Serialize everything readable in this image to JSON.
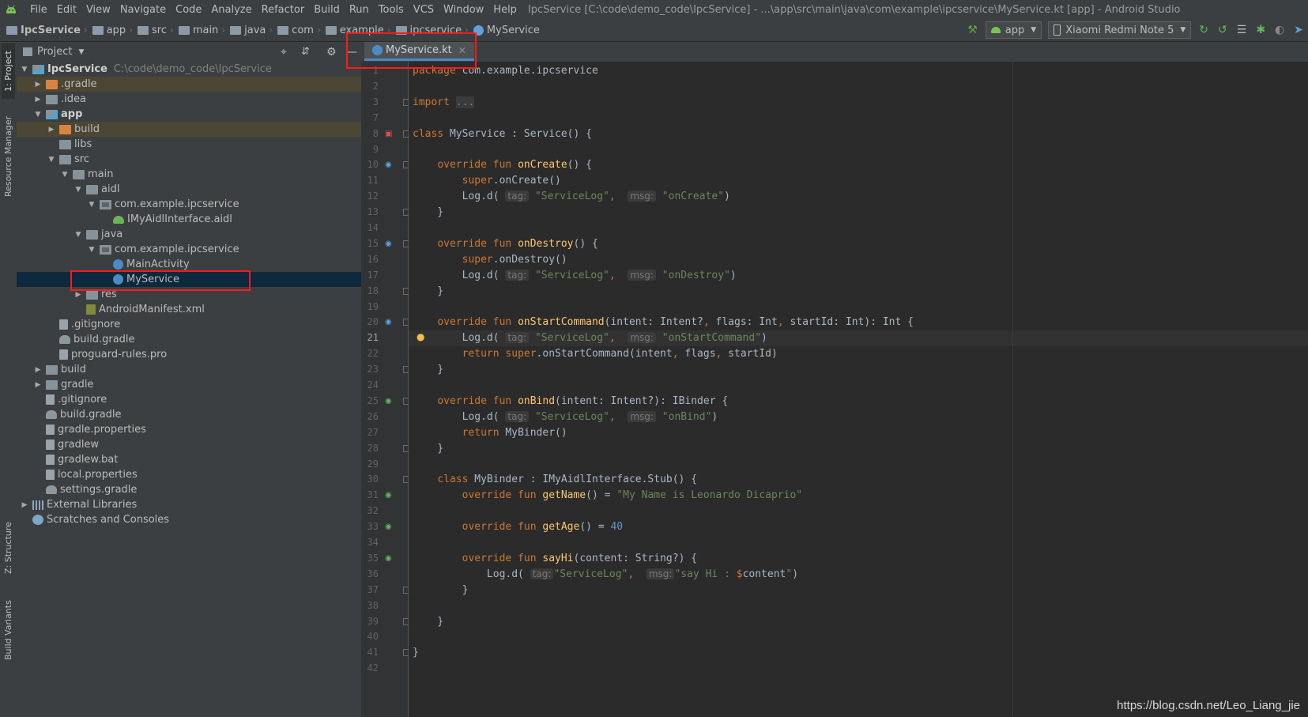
{
  "menubar": {
    "items": [
      "File",
      "Edit",
      "View",
      "Navigate",
      "Code",
      "Analyze",
      "Refactor",
      "Build",
      "Run",
      "Tools",
      "VCS",
      "Window",
      "Help"
    ],
    "mnemonics": [
      "F",
      "E",
      "V",
      "N",
      "C",
      "z",
      "R",
      "B",
      "u",
      "T",
      "S",
      "W",
      "H"
    ],
    "window_title": "IpcService [C:\\code\\demo_code\\IpcService] - ...\\app\\src\\main\\java\\com\\example\\ipcservice\\MyService.kt [app] - Android Studio"
  },
  "breadcrumbs": [
    "IpcService",
    "app",
    "src",
    "main",
    "java",
    "com",
    "example",
    "ipcservice",
    "MyService"
  ],
  "toolbar": {
    "run_config": "app",
    "device": "Xiaomi Redmi Note 5"
  },
  "stripe": {
    "project_tab": "1: Project",
    "resource_tab": "Resource Manager",
    "structure_tab": "Z: Structure",
    "variants_tab": "Build Variants"
  },
  "project_panel": {
    "title": "Project",
    "tree": [
      {
        "label": "IpcService",
        "path": "C:\\code\\demo_code\\IpcService",
        "depth": 0,
        "arrow": "down",
        "icon": "modfolder",
        "bold": true
      },
      {
        "label": ".gradle",
        "depth": 1,
        "arrow": "right",
        "icon": "ofolder",
        "hl": true
      },
      {
        "label": ".idea",
        "depth": 1,
        "arrow": "right",
        "icon": "folder"
      },
      {
        "label": "app",
        "depth": 1,
        "arrow": "down",
        "icon": "modfolder",
        "bold": true
      },
      {
        "label": "build",
        "depth": 2,
        "arrow": "right",
        "icon": "ofolder",
        "hl": true
      },
      {
        "label": "libs",
        "depth": 2,
        "arrow": "",
        "icon": "folder"
      },
      {
        "label": "src",
        "depth": 2,
        "arrow": "down",
        "icon": "folder"
      },
      {
        "label": "main",
        "depth": 3,
        "arrow": "down",
        "icon": "folder"
      },
      {
        "label": "aidl",
        "depth": 4,
        "arrow": "down",
        "icon": "folder"
      },
      {
        "label": "com.example.ipcservice",
        "depth": 5,
        "arrow": "down",
        "icon": "pkg"
      },
      {
        "label": "IMyAidlInterface.aidl",
        "depth": 6,
        "arrow": "",
        "icon": "andr"
      },
      {
        "label": "java",
        "depth": 4,
        "arrow": "down",
        "icon": "folder"
      },
      {
        "label": "com.example.ipcservice",
        "depth": 5,
        "arrow": "down",
        "icon": "pkg"
      },
      {
        "label": "MainActivity",
        "depth": 6,
        "arrow": "",
        "icon": "kt"
      },
      {
        "label": "MyService",
        "depth": 6,
        "arrow": "",
        "icon": "kt",
        "sel": true
      },
      {
        "label": "res",
        "depth": 4,
        "arrow": "right",
        "icon": "folder"
      },
      {
        "label": "AndroidManifest.xml",
        "depth": 4,
        "arrow": "",
        "icon": "xml"
      },
      {
        "label": ".gitignore",
        "depth": 2,
        "arrow": "",
        "icon": "file"
      },
      {
        "label": "build.gradle",
        "depth": 2,
        "arrow": "",
        "icon": "gradle"
      },
      {
        "label": "proguard-rules.pro",
        "depth": 2,
        "arrow": "",
        "icon": "file"
      },
      {
        "label": "build",
        "depth": 1,
        "arrow": "right",
        "icon": "folder"
      },
      {
        "label": "gradle",
        "depth": 1,
        "arrow": "right",
        "icon": "folder"
      },
      {
        "label": ".gitignore",
        "depth": 1,
        "arrow": "",
        "icon": "file"
      },
      {
        "label": "build.gradle",
        "depth": 1,
        "arrow": "",
        "icon": "gradle"
      },
      {
        "label": "gradle.properties",
        "depth": 1,
        "arrow": "",
        "icon": "file"
      },
      {
        "label": "gradlew",
        "depth": 1,
        "arrow": "",
        "icon": "file"
      },
      {
        "label": "gradlew.bat",
        "depth": 1,
        "arrow": "",
        "icon": "file"
      },
      {
        "label": "local.properties",
        "depth": 1,
        "arrow": "",
        "icon": "file"
      },
      {
        "label": "settings.gradle",
        "depth": 1,
        "arrow": "",
        "icon": "gradle"
      },
      {
        "label": "External Libraries",
        "depth": 0,
        "arrow": "right",
        "icon": "lib"
      },
      {
        "label": "Scratches and Consoles",
        "depth": 0,
        "arrow": "",
        "icon": "scr"
      }
    ]
  },
  "editor": {
    "tab_label": "MyService.kt",
    "current_line": 21,
    "lines": [
      {
        "n": 1,
        "code": [
          [
            "kw",
            "package"
          ],
          [
            "pl",
            " com.example.ipcservice"
          ]
        ]
      },
      {
        "n": 2,
        "code": []
      },
      {
        "n": 3,
        "code": [
          [
            "kw",
            "import"
          ],
          [
            "pl",
            " "
          ],
          [
            "dim",
            "..."
          ]
        ]
      },
      {
        "n": 7,
        "code": []
      },
      {
        "n": 8,
        "code": [
          [
            "kw",
            "class"
          ],
          [
            "pl",
            " MyService : Service() {"
          ]
        ]
      },
      {
        "n": 9,
        "code": []
      },
      {
        "n": 10,
        "code": [
          [
            "pl",
            "    "
          ],
          [
            "kw",
            "override fun"
          ],
          [
            "pl",
            " "
          ],
          [
            "fn",
            "onCreate"
          ],
          [
            "pl",
            "() {"
          ]
        ]
      },
      {
        "n": 11,
        "code": [
          [
            "pl",
            "        "
          ],
          [
            "kw",
            "super"
          ],
          [
            "pl",
            ".onCreate()"
          ]
        ]
      },
      {
        "n": 12,
        "code": [
          [
            "pl",
            "        Log.d( "
          ],
          [
            "hint",
            "tag:"
          ],
          [
            "pl",
            " "
          ],
          [
            "st",
            "\"ServiceLog\""
          ],
          [
            "fv",
            ","
          ],
          [
            "pl",
            "  "
          ],
          [
            "hint",
            "msg:"
          ],
          [
            "pl",
            " "
          ],
          [
            "st",
            "\"onCreate\""
          ],
          [
            "pl",
            ")"
          ]
        ]
      },
      {
        "n": 13,
        "code": [
          [
            "pl",
            "    }"
          ]
        ]
      },
      {
        "n": 14,
        "code": []
      },
      {
        "n": 15,
        "code": [
          [
            "pl",
            "    "
          ],
          [
            "kw",
            "override fun"
          ],
          [
            "pl",
            " "
          ],
          [
            "fn",
            "onDestroy"
          ],
          [
            "pl",
            "() {"
          ]
        ]
      },
      {
        "n": 16,
        "code": [
          [
            "pl",
            "        "
          ],
          [
            "kw",
            "super"
          ],
          [
            "pl",
            ".onDestroy()"
          ]
        ]
      },
      {
        "n": 17,
        "code": [
          [
            "pl",
            "        Log.d( "
          ],
          [
            "hint",
            "tag:"
          ],
          [
            "pl",
            " "
          ],
          [
            "st",
            "\"ServiceLog\""
          ],
          [
            "fv",
            ","
          ],
          [
            "pl",
            "  "
          ],
          [
            "hint",
            "msg:"
          ],
          [
            "pl",
            " "
          ],
          [
            "st",
            "\"onDestroy\""
          ],
          [
            "pl",
            ")"
          ]
        ]
      },
      {
        "n": 18,
        "code": [
          [
            "pl",
            "    }"
          ]
        ]
      },
      {
        "n": 19,
        "code": []
      },
      {
        "n": 20,
        "code": [
          [
            "pl",
            "    "
          ],
          [
            "kw",
            "override fun"
          ],
          [
            "pl",
            " "
          ],
          [
            "fn",
            "onStartCommand"
          ],
          [
            "pl",
            "(intent: Intent?"
          ],
          [
            "fv",
            ","
          ],
          [
            "pl",
            " flags: Int"
          ],
          [
            "fv",
            ","
          ],
          [
            "pl",
            " startId: Int): Int {"
          ]
        ]
      },
      {
        "n": 21,
        "code": [
          [
            "pl",
            "        Log.d( "
          ],
          [
            "hint",
            "tag:"
          ],
          [
            "pl",
            " "
          ],
          [
            "st",
            "\"ServiceLog\""
          ],
          [
            "fv",
            ","
          ],
          [
            "pl",
            "  "
          ],
          [
            "hint",
            "msg:"
          ],
          [
            "pl",
            " "
          ],
          [
            "st",
            "\"onStartCommand\""
          ],
          [
            "pl",
            ")"
          ]
        ]
      },
      {
        "n": 22,
        "code": [
          [
            "pl",
            "        "
          ],
          [
            "kw",
            "return super"
          ],
          [
            "pl",
            ".onStartCommand(intent"
          ],
          [
            "fv",
            ","
          ],
          [
            "pl",
            " flags"
          ],
          [
            "fv",
            ","
          ],
          [
            "pl",
            " startId)"
          ]
        ]
      },
      {
        "n": 23,
        "code": [
          [
            "pl",
            "    }"
          ]
        ]
      },
      {
        "n": 24,
        "code": []
      },
      {
        "n": 25,
        "code": [
          [
            "pl",
            "    "
          ],
          [
            "kw",
            "override fun"
          ],
          [
            "pl",
            " "
          ],
          [
            "fn",
            "onBind"
          ],
          [
            "pl",
            "(intent: Intent?): IBinder {"
          ]
        ]
      },
      {
        "n": 26,
        "code": [
          [
            "pl",
            "        Log.d( "
          ],
          [
            "hint",
            "tag:"
          ],
          [
            "pl",
            " "
          ],
          [
            "st",
            "\"ServiceLog\""
          ],
          [
            "fv",
            ","
          ],
          [
            "pl",
            "  "
          ],
          [
            "hint",
            "msg:"
          ],
          [
            "pl",
            " "
          ],
          [
            "st",
            "\"onBind\""
          ],
          [
            "pl",
            ")"
          ]
        ]
      },
      {
        "n": 27,
        "code": [
          [
            "pl",
            "        "
          ],
          [
            "kw",
            "return"
          ],
          [
            "pl",
            " MyBinder()"
          ]
        ]
      },
      {
        "n": 28,
        "code": [
          [
            "pl",
            "    }"
          ]
        ]
      },
      {
        "n": 29,
        "code": []
      },
      {
        "n": 30,
        "code": [
          [
            "pl",
            "    "
          ],
          [
            "kw",
            "class"
          ],
          [
            "pl",
            " MyBinder : IMyAidlInterface.Stub() {"
          ]
        ]
      },
      {
        "n": 31,
        "code": [
          [
            "pl",
            "        "
          ],
          [
            "kw",
            "override fun"
          ],
          [
            "pl",
            " "
          ],
          [
            "fn",
            "getName"
          ],
          [
            "pl",
            "() = "
          ],
          [
            "st",
            "\"My Name is Leonardo Dicaprio\""
          ]
        ]
      },
      {
        "n": 32,
        "code": []
      },
      {
        "n": 33,
        "code": [
          [
            "pl",
            "        "
          ],
          [
            "kw",
            "override fun"
          ],
          [
            "pl",
            " "
          ],
          [
            "fn",
            "getAge"
          ],
          [
            "pl",
            "() = "
          ],
          [
            "nm",
            "40"
          ]
        ]
      },
      {
        "n": 34,
        "code": []
      },
      {
        "n": 35,
        "code": [
          [
            "pl",
            "        "
          ],
          [
            "kw",
            "override fun"
          ],
          [
            "pl",
            " "
          ],
          [
            "fn",
            "sayHi"
          ],
          [
            "pl",
            "(content: String?) {"
          ]
        ]
      },
      {
        "n": 36,
        "code": [
          [
            "pl",
            "            Log.d( "
          ],
          [
            "hint",
            "tag:"
          ],
          [
            "st",
            "\"ServiceLog\""
          ],
          [
            "fv",
            ","
          ],
          [
            "pl",
            "  "
          ],
          [
            "hint",
            "msg:"
          ],
          [
            "st",
            "\"say Hi : "
          ],
          [
            "kw",
            "$"
          ],
          [
            "pl",
            "content"
          ],
          [
            "st",
            "\""
          ],
          [
            "pl",
            ")"
          ]
        ]
      },
      {
        "n": 37,
        "code": [
          [
            "pl",
            "        }"
          ]
        ]
      },
      {
        "n": 38,
        "code": []
      },
      {
        "n": 39,
        "code": [
          [
            "pl",
            "    }"
          ]
        ]
      },
      {
        "n": 40,
        "code": []
      },
      {
        "n": 41,
        "code": [
          [
            "pl",
            "}"
          ]
        ]
      },
      {
        "n": 42,
        "code": []
      }
    ]
  },
  "watermark": "https://blog.csdn.net/Leo_Liang_jie",
  "colors": {
    "highlight_box": "#ff1a1a",
    "keyword": "#cc7832",
    "function": "#ffc66d",
    "string": "#6a8759",
    "number": "#6897bb",
    "selection": "#0d293e"
  }
}
